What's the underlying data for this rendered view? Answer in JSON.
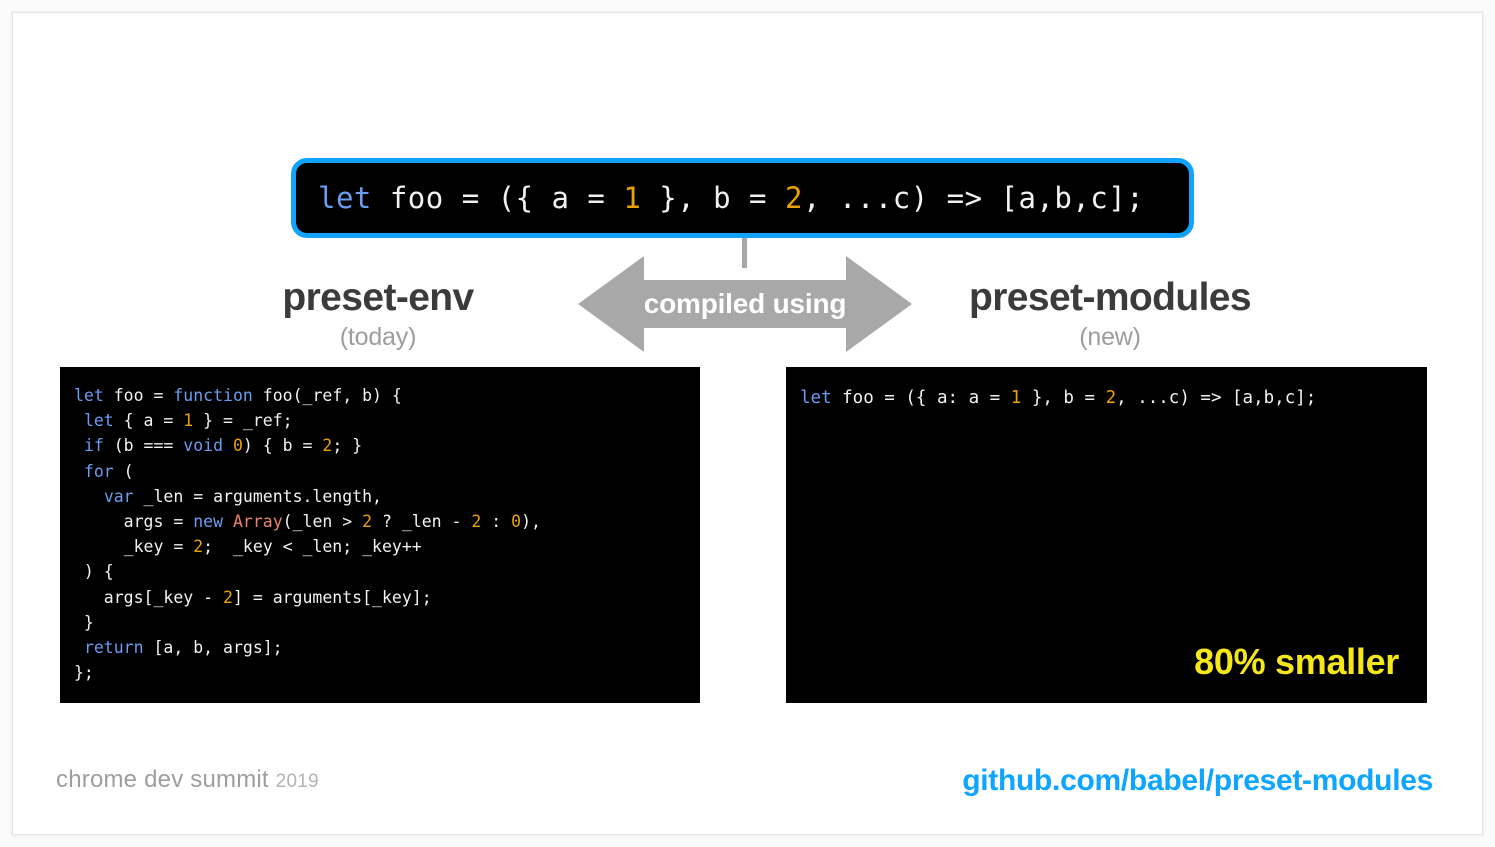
{
  "slide": {
    "source_box": {
      "code_tokens": [
        {
          "t": "let",
          "c": "kw"
        },
        {
          "t": " foo = ({ a = ",
          "c": "plain"
        },
        {
          "t": "1",
          "c": "num"
        },
        {
          "t": " }, b = ",
          "c": "plain"
        },
        {
          "t": "2",
          "c": "num"
        },
        {
          "t": ", ...c) => [a,b,c];",
          "c": "plain"
        }
      ],
      "border_color": "#11a3ff",
      "background": "#000000"
    },
    "arrow": {
      "label": "compiled using",
      "color": "#a8a8a8"
    },
    "columns": [
      {
        "title": "preset-env",
        "subtitle": "(today)"
      },
      {
        "title": "preset-modules",
        "subtitle": "(new)"
      }
    ],
    "left_panel": {
      "lines": [
        [
          {
            "t": "let",
            "c": "kw"
          },
          {
            "t": " foo = ",
            "c": "plain"
          },
          {
            "t": "function",
            "c": "kw"
          },
          {
            "t": " foo(_ref, b) {",
            "c": "plain"
          }
        ],
        [
          {
            "t": " ",
            "c": "plain"
          },
          {
            "t": "let",
            "c": "kw"
          },
          {
            "t": " { a = ",
            "c": "plain"
          },
          {
            "t": "1",
            "c": "num"
          },
          {
            "t": " } = _ref;",
            "c": "plain"
          }
        ],
        [
          {
            "t": " ",
            "c": "plain"
          },
          {
            "t": "if",
            "c": "kw"
          },
          {
            "t": " (b === ",
            "c": "plain"
          },
          {
            "t": "void",
            "c": "kw"
          },
          {
            "t": " ",
            "c": "plain"
          },
          {
            "t": "0",
            "c": "num"
          },
          {
            "t": ") { b = ",
            "c": "plain"
          },
          {
            "t": "2",
            "c": "num"
          },
          {
            "t": "; }",
            "c": "plain"
          }
        ],
        [
          {
            "t": " ",
            "c": "plain"
          },
          {
            "t": "for",
            "c": "kw"
          },
          {
            "t": " (",
            "c": "plain"
          }
        ],
        [
          {
            "t": "   ",
            "c": "plain"
          },
          {
            "t": "var",
            "c": "kw"
          },
          {
            "t": " _len = arguments.length,",
            "c": "plain"
          }
        ],
        [
          {
            "t": "     args = ",
            "c": "plain"
          },
          {
            "t": "new",
            "c": "kw"
          },
          {
            "t": " ",
            "c": "plain"
          },
          {
            "t": "Array",
            "c": "cls"
          },
          {
            "t": "(_len > ",
            "c": "plain"
          },
          {
            "t": "2",
            "c": "num"
          },
          {
            "t": " ? _len - ",
            "c": "plain"
          },
          {
            "t": "2",
            "c": "num"
          },
          {
            "t": " : ",
            "c": "plain"
          },
          {
            "t": "0",
            "c": "num"
          },
          {
            "t": "),",
            "c": "plain"
          }
        ],
        [
          {
            "t": "     _key = ",
            "c": "plain"
          },
          {
            "t": "2",
            "c": "num"
          },
          {
            "t": ";  _key < _len; _key++",
            "c": "plain"
          }
        ],
        [
          {
            "t": " ) {",
            "c": "plain"
          }
        ],
        [
          {
            "t": "   args[_key - ",
            "c": "plain"
          },
          {
            "t": "2",
            "c": "num"
          },
          {
            "t": "] = arguments[_key];",
            "c": "plain"
          }
        ],
        [
          {
            "t": " }",
            "c": "plain"
          }
        ],
        [
          {
            "t": " ",
            "c": "plain"
          },
          {
            "t": "return",
            "c": "kw"
          },
          {
            "t": " [a, b, args];",
            "c": "plain"
          }
        ],
        [
          {
            "t": "};",
            "c": "plain"
          }
        ]
      ]
    },
    "right_panel": {
      "lines": [
        [
          {
            "t": "let",
            "c": "kw"
          },
          {
            "t": " foo = ({ a: a = ",
            "c": "plain"
          },
          {
            "t": "1",
            "c": "num"
          },
          {
            "t": " }, b = ",
            "c": "plain"
          },
          {
            "t": "2",
            "c": "num"
          },
          {
            "t": ", ...c) => [a,b,c];",
            "c": "plain"
          }
        ]
      ],
      "badge": "80% smaller",
      "badge_color": "#f5e71a"
    },
    "footer": {
      "brand": "chrome dev summit",
      "year": "2019",
      "link": "github.com/babel/preset-modules",
      "link_color": "#0ea5ff"
    }
  }
}
